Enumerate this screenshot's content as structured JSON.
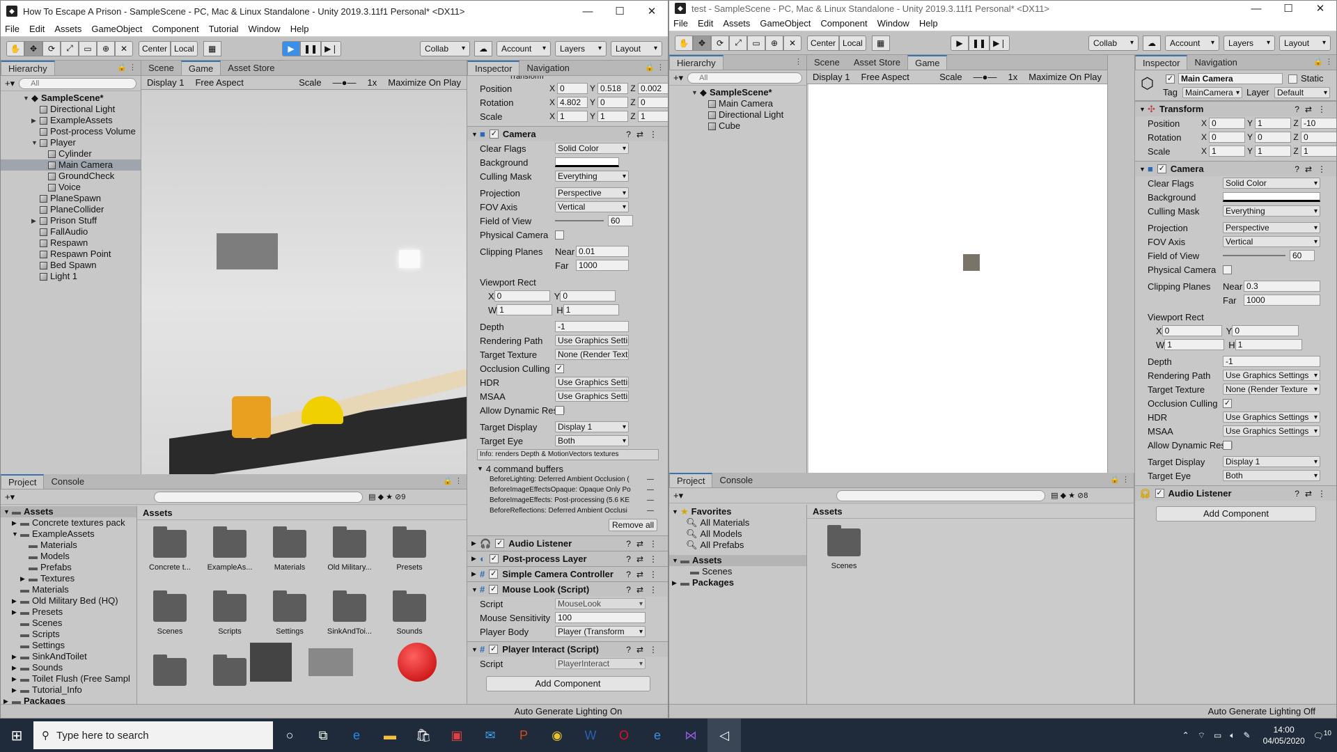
{
  "left_window": {
    "title": "How To Escape A Prison - SampleScene - PC, Mac & Linux Standalone - Unity 2019.3.11f1 Personal* <DX11>",
    "menu": [
      "File",
      "Edit",
      "Assets",
      "GameObject",
      "Component",
      "Tutorial",
      "Window",
      "Help"
    ],
    "toolbar": {
      "center": "Center",
      "local": "Local",
      "collab": "Collab",
      "account": "Account",
      "layers": "Layers",
      "layout": "Layout"
    },
    "hierarchy": {
      "tab": "Hierarchy",
      "search": "All",
      "scene": "SampleScene*",
      "items": [
        {
          "label": "Directional Light",
          "indent": 1,
          "arrow": ""
        },
        {
          "label": "ExampleAssets",
          "indent": 1,
          "arrow": "▶"
        },
        {
          "label": "Post-process Volume",
          "indent": 1,
          "arrow": ""
        },
        {
          "label": "Player",
          "indent": 1,
          "arrow": "▼"
        },
        {
          "label": "Cylinder",
          "indent": 2,
          "arrow": ""
        },
        {
          "label": "Main Camera",
          "indent": 2,
          "arrow": "",
          "selected": true
        },
        {
          "label": "GroundCheck",
          "indent": 2,
          "arrow": ""
        },
        {
          "label": "Voice",
          "indent": 2,
          "arrow": ""
        },
        {
          "label": "PlaneSpawn",
          "indent": 1,
          "arrow": ""
        },
        {
          "label": "PlaneCollider",
          "indent": 1,
          "arrow": ""
        },
        {
          "label": "Prison Stuff",
          "indent": 1,
          "arrow": "▶"
        },
        {
          "label": "FallAudio",
          "indent": 1,
          "arrow": ""
        },
        {
          "label": "Respawn",
          "indent": 1,
          "arrow": ""
        },
        {
          "label": "Respawn Point",
          "indent": 1,
          "arrow": ""
        },
        {
          "label": "Bed Spawn",
          "indent": 1,
          "arrow": ""
        },
        {
          "label": "Light 1",
          "indent": 1,
          "arrow": ""
        }
      ]
    },
    "scene_tabs": [
      "Scene",
      "Game",
      "Asset Store"
    ],
    "game_bar": {
      "display": "Display 1",
      "aspect": "Free Aspect",
      "scale_label": "Scale",
      "scale_value": "1x",
      "maximize": "Maximize On Play"
    },
    "inspector": {
      "tabs": [
        "Inspector",
        "Navigation"
      ],
      "transform_title": "Transform",
      "position": {
        "label": "Position",
        "x": "0",
        "y": "0.518",
        "z": "0.002"
      },
      "rotation": {
        "label": "Rotation",
        "x": "4.802",
        "y": "0",
        "z": "0"
      },
      "scale": {
        "label": "Scale",
        "x": "1",
        "y": "1",
        "z": "1"
      },
      "camera_title": "Camera",
      "clear_flags": {
        "label": "Clear Flags",
        "value": "Solid Color"
      },
      "background_label": "Background",
      "culling_mask": {
        "label": "Culling Mask",
        "value": "Everything"
      },
      "projection": {
        "label": "Projection",
        "value": "Perspective"
      },
      "fov_axis": {
        "label": "FOV Axis",
        "value": "Vertical"
      },
      "fov": {
        "label": "Field of View",
        "value": "60"
      },
      "physical_camera": "Physical Camera",
      "clipping": {
        "label": "Clipping Planes",
        "near_label": "Near",
        "near": "0.01",
        "far_label": "Far",
        "far": "1000"
      },
      "viewport": {
        "label": "Viewport Rect",
        "x": "0",
        "y": "0",
        "w": "1",
        "h": "1"
      },
      "depth": {
        "label": "Depth",
        "value": "-1"
      },
      "rendering_path": {
        "label": "Rendering Path",
        "value": "Use Graphics Settin"
      },
      "target_texture": {
        "label": "Target Texture",
        "value": "None (Render Textu"
      },
      "occlusion": "Occlusion Culling",
      "hdr": {
        "label": "HDR",
        "value": "Use Graphics Settin"
      },
      "msaa": {
        "label": "MSAA",
        "value": "Use Graphics Settin"
      },
      "dynamic_res": "Allow Dynamic Resol",
      "target_display": {
        "label": "Target Display",
        "value": "Display 1"
      },
      "target_eye": {
        "label": "Target Eye",
        "value": "Both"
      },
      "info": "Info: renders Depth & MotionVectors textures",
      "cmd_title": "4 command buffers",
      "cmd_buffers": [
        "BeforeLighting: Deferred Ambient Occlusion (",
        "BeforeImageEffectsOpaque: Opaque Only Po",
        "BeforeImageEffects: Post-processing (5.6 KE",
        "BeforeReflections: Deferred Ambient Occlusi"
      ],
      "remove_all": "Remove all",
      "components": [
        {
          "name": "Audio Listener",
          "icon": "🎧"
        },
        {
          "name": "Post-process Layer",
          "icon": "◐"
        },
        {
          "name": "Simple Camera Controller",
          "icon": "#"
        },
        {
          "name": "Mouse Look (Script)",
          "icon": "#"
        }
      ],
      "mouselook": {
        "script_label": "Script",
        "script": "MouseLook",
        "sens_label": "Mouse Sensitivity",
        "sens": "100",
        "body_label": "Player Body",
        "body": "Player (Transform"
      },
      "player_interact": {
        "name": "Player Interact (Script)",
        "script_label": "Script",
        "script": "PlayerInteract"
      },
      "add_component": "Add Component"
    },
    "project": {
      "tabs": [
        "Project",
        "Console"
      ],
      "count": "9",
      "tree": [
        {
          "label": "Assets",
          "indent": 0,
          "arrow": "▼",
          "bold": true
        },
        {
          "label": "Concrete textures pack",
          "indent": 1,
          "arrow": "▶"
        },
        {
          "label": "ExampleAssets",
          "indent": 1,
          "arrow": "▼"
        },
        {
          "label": "Materials",
          "indent": 2,
          "arrow": ""
        },
        {
          "label": "Models",
          "indent": 2,
          "arrow": ""
        },
        {
          "label": "Prefabs",
          "indent": 2,
          "arrow": ""
        },
        {
          "label": "Textures",
          "indent": 2,
          "arrow": "▶"
        },
        {
          "label": "Materials",
          "indent": 1,
          "arrow": ""
        },
        {
          "label": "Old Military Bed (HQ)",
          "indent": 1,
          "arrow": "▶"
        },
        {
          "label": "Presets",
          "indent": 1,
          "arrow": "▶"
        },
        {
          "label": "Scenes",
          "indent": 1,
          "arrow": ""
        },
        {
          "label": "Scripts",
          "indent": 1,
          "arrow": ""
        },
        {
          "label": "Settings",
          "indent": 1,
          "arrow": ""
        },
        {
          "label": "SinkAndToilet",
          "indent": 1,
          "arrow": "▶"
        },
        {
          "label": "Sounds",
          "indent": 1,
          "arrow": "▶"
        },
        {
          "label": "Toilet Flush (Free Sampl",
          "indent": 1,
          "arrow": "▶"
        },
        {
          "label": "Tutorial_Info",
          "indent": 1,
          "arrow": "▶"
        },
        {
          "label": "Packages",
          "indent": 0,
          "arrow": "▶",
          "bold": true
        }
      ],
      "assets_title": "Assets",
      "assets": [
        "Concrete t...",
        "ExampleAs...",
        "Materials",
        "Old Military...",
        "Presets",
        "Scenes",
        "Scripts",
        "Settings",
        "SinkAndToi...",
        "Sounds"
      ]
    },
    "status": "Auto Generate Lighting On"
  },
  "right_window": {
    "title": "test - SampleScene - PC, Mac & Linux Standalone - Unity 2019.3.11f1 Personal* <DX11>",
    "menu": [
      "File",
      "Edit",
      "Assets",
      "GameObject",
      "Component",
      "Window",
      "Help"
    ],
    "toolbar": {
      "center": "Center",
      "local": "Local",
      "collab": "Collab",
      "account": "Account",
      "layers": "Layers",
      "layout": "Layout"
    },
    "hierarchy": {
      "tab": "Hierarchy",
      "search": "All",
      "scene": "SampleScene*",
      "items": [
        "Main Camera",
        "Directional Light",
        "Cube"
      ]
    },
    "scene_tabs": [
      "Scene",
      "Asset Store",
      "Game"
    ],
    "game_bar": {
      "display": "Display 1",
      "aspect": "Free Aspect",
      "scale_label": "Scale",
      "scale_value": "1x",
      "maximize": "Maximize On Play"
    },
    "inspector": {
      "tabs": [
        "Inspector",
        "Navigation"
      ],
      "object_name": "Main Camera",
      "static": "Static",
      "tag_label": "Tag",
      "tag": "MainCamera",
      "layer_label": "Layer",
      "layer": "Default",
      "transform_title": "Transform",
      "position": {
        "label": "Position",
        "x": "0",
        "y": "1",
        "z": "-10"
      },
      "rotation": {
        "label": "Rotation",
        "x": "0",
        "y": "0",
        "z": "0"
      },
      "scale": {
        "label": "Scale",
        "x": "1",
        "y": "1",
        "z": "1"
      },
      "camera_title": "Camera",
      "clear_flags": {
        "label": "Clear Flags",
        "value": "Solid Color"
      },
      "background_label": "Background",
      "culling_mask": {
        "label": "Culling Mask",
        "value": "Everything"
      },
      "projection": {
        "label": "Projection",
        "value": "Perspective"
      },
      "fov_axis": {
        "label": "FOV Axis",
        "value": "Vertical"
      },
      "fov": {
        "label": "Field of View",
        "value": "60"
      },
      "physical_camera": "Physical Camera",
      "clipping": {
        "label": "Clipping Planes",
        "near_label": "Near",
        "near": "0.3",
        "far_label": "Far",
        "far": "1000"
      },
      "viewport": {
        "label": "Viewport Rect",
        "x": "0",
        "y": "0",
        "w": "1",
        "h": "1"
      },
      "depth": {
        "label": "Depth",
        "value": "-1"
      },
      "rendering_path": {
        "label": "Rendering Path",
        "value": "Use Graphics Settings"
      },
      "target_texture": {
        "label": "Target Texture",
        "value": "None (Render Texture"
      },
      "occlusion": "Occlusion Culling",
      "hdr": {
        "label": "HDR",
        "value": "Use Graphics Settings"
      },
      "msaa": {
        "label": "MSAA",
        "value": "Use Graphics Settings"
      },
      "dynamic_res": "Allow Dynamic Resol",
      "target_display": {
        "label": "Target Display",
        "value": "Display 1"
      },
      "target_eye": {
        "label": "Target Eye",
        "value": "Both"
      },
      "audio_listener": "Audio Listener",
      "add_component": "Add Component"
    },
    "project": {
      "tabs": [
        "Project",
        "Console"
      ],
      "count": "8",
      "favorites": "Favorites",
      "fav_items": [
        "All Materials",
        "All Models",
        "All Prefabs"
      ],
      "assets": "Assets",
      "scenes": "Scenes",
      "packages": "Packages",
      "assets_title": "Assets",
      "asset_items": [
        "Scenes"
      ]
    },
    "status": "Auto Generate Lighting Off"
  },
  "taskbar": {
    "search": "Type here to search",
    "time": "14:00",
    "date": "04/05/2020",
    "notif": "10"
  }
}
